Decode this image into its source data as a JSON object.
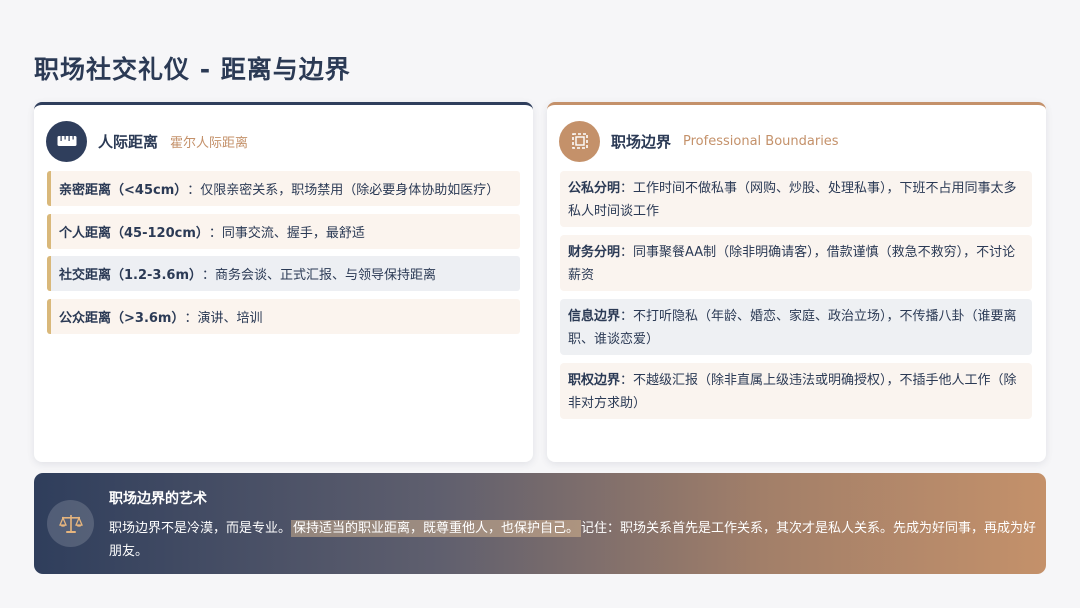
{
  "page": {
    "title": "职场社交礼仪 - 距离与边界"
  },
  "left_card": {
    "title": "人际距离",
    "subtitle": "霍尔人际距离",
    "icon": "ruler-icon",
    "items": [
      {
        "label": "亲密距离（<45cm）",
        "text": "：仅限亲密关系，职场禁用（除必要身体协助如医疗）"
      },
      {
        "label": "个人距离（45-120cm）",
        "text": "：同事交流、握手，最舒适"
      },
      {
        "label": "社交距离（1.2-3.6m）",
        "text": "：商务会谈、正式汇报、与领导保持距离"
      },
      {
        "label": "公众距离（>3.6m）",
        "text": "：演讲、培训"
      }
    ]
  },
  "right_card": {
    "title": "职场边界",
    "subtitle": "Professional Boundaries",
    "icon": "boundary-frame-icon",
    "items": [
      {
        "label": "公私分明",
        "text": "：工作时间不做私事（网购、炒股、处理私事），下班不占用同事太多私人时间谈工作"
      },
      {
        "label": "财务分明",
        "text": "：同事聚餐AA制（除非明确请客），借款谨慎（救急不救穷），不讨论薪资"
      },
      {
        "label": "信息边界",
        "text": "：不打听隐私（年龄、婚恋、家庭、政治立场），不传播八卦（谁要离职、谁谈恋爱）"
      },
      {
        "label": "职权边界",
        "text": "：不越级汇报（除非直属上级违法或明确授权），不插手他人工作（除非对方求助）"
      }
    ]
  },
  "banner": {
    "title": "职场边界的艺术",
    "icon": "balance-scale-icon",
    "text_before": "职场边界不是冷漠，而是专业。",
    "text_highlight": "保持适当的职业距离，既尊重他人，也保护自己。",
    "text_after": "记住：职场关系首先是工作关系，其次才是私人关系。先成为好同事，再成为好朋友。"
  },
  "colors": {
    "navy": "#2f3e5c",
    "tan": "#c4916a",
    "gold_border": "#d9b87a"
  }
}
